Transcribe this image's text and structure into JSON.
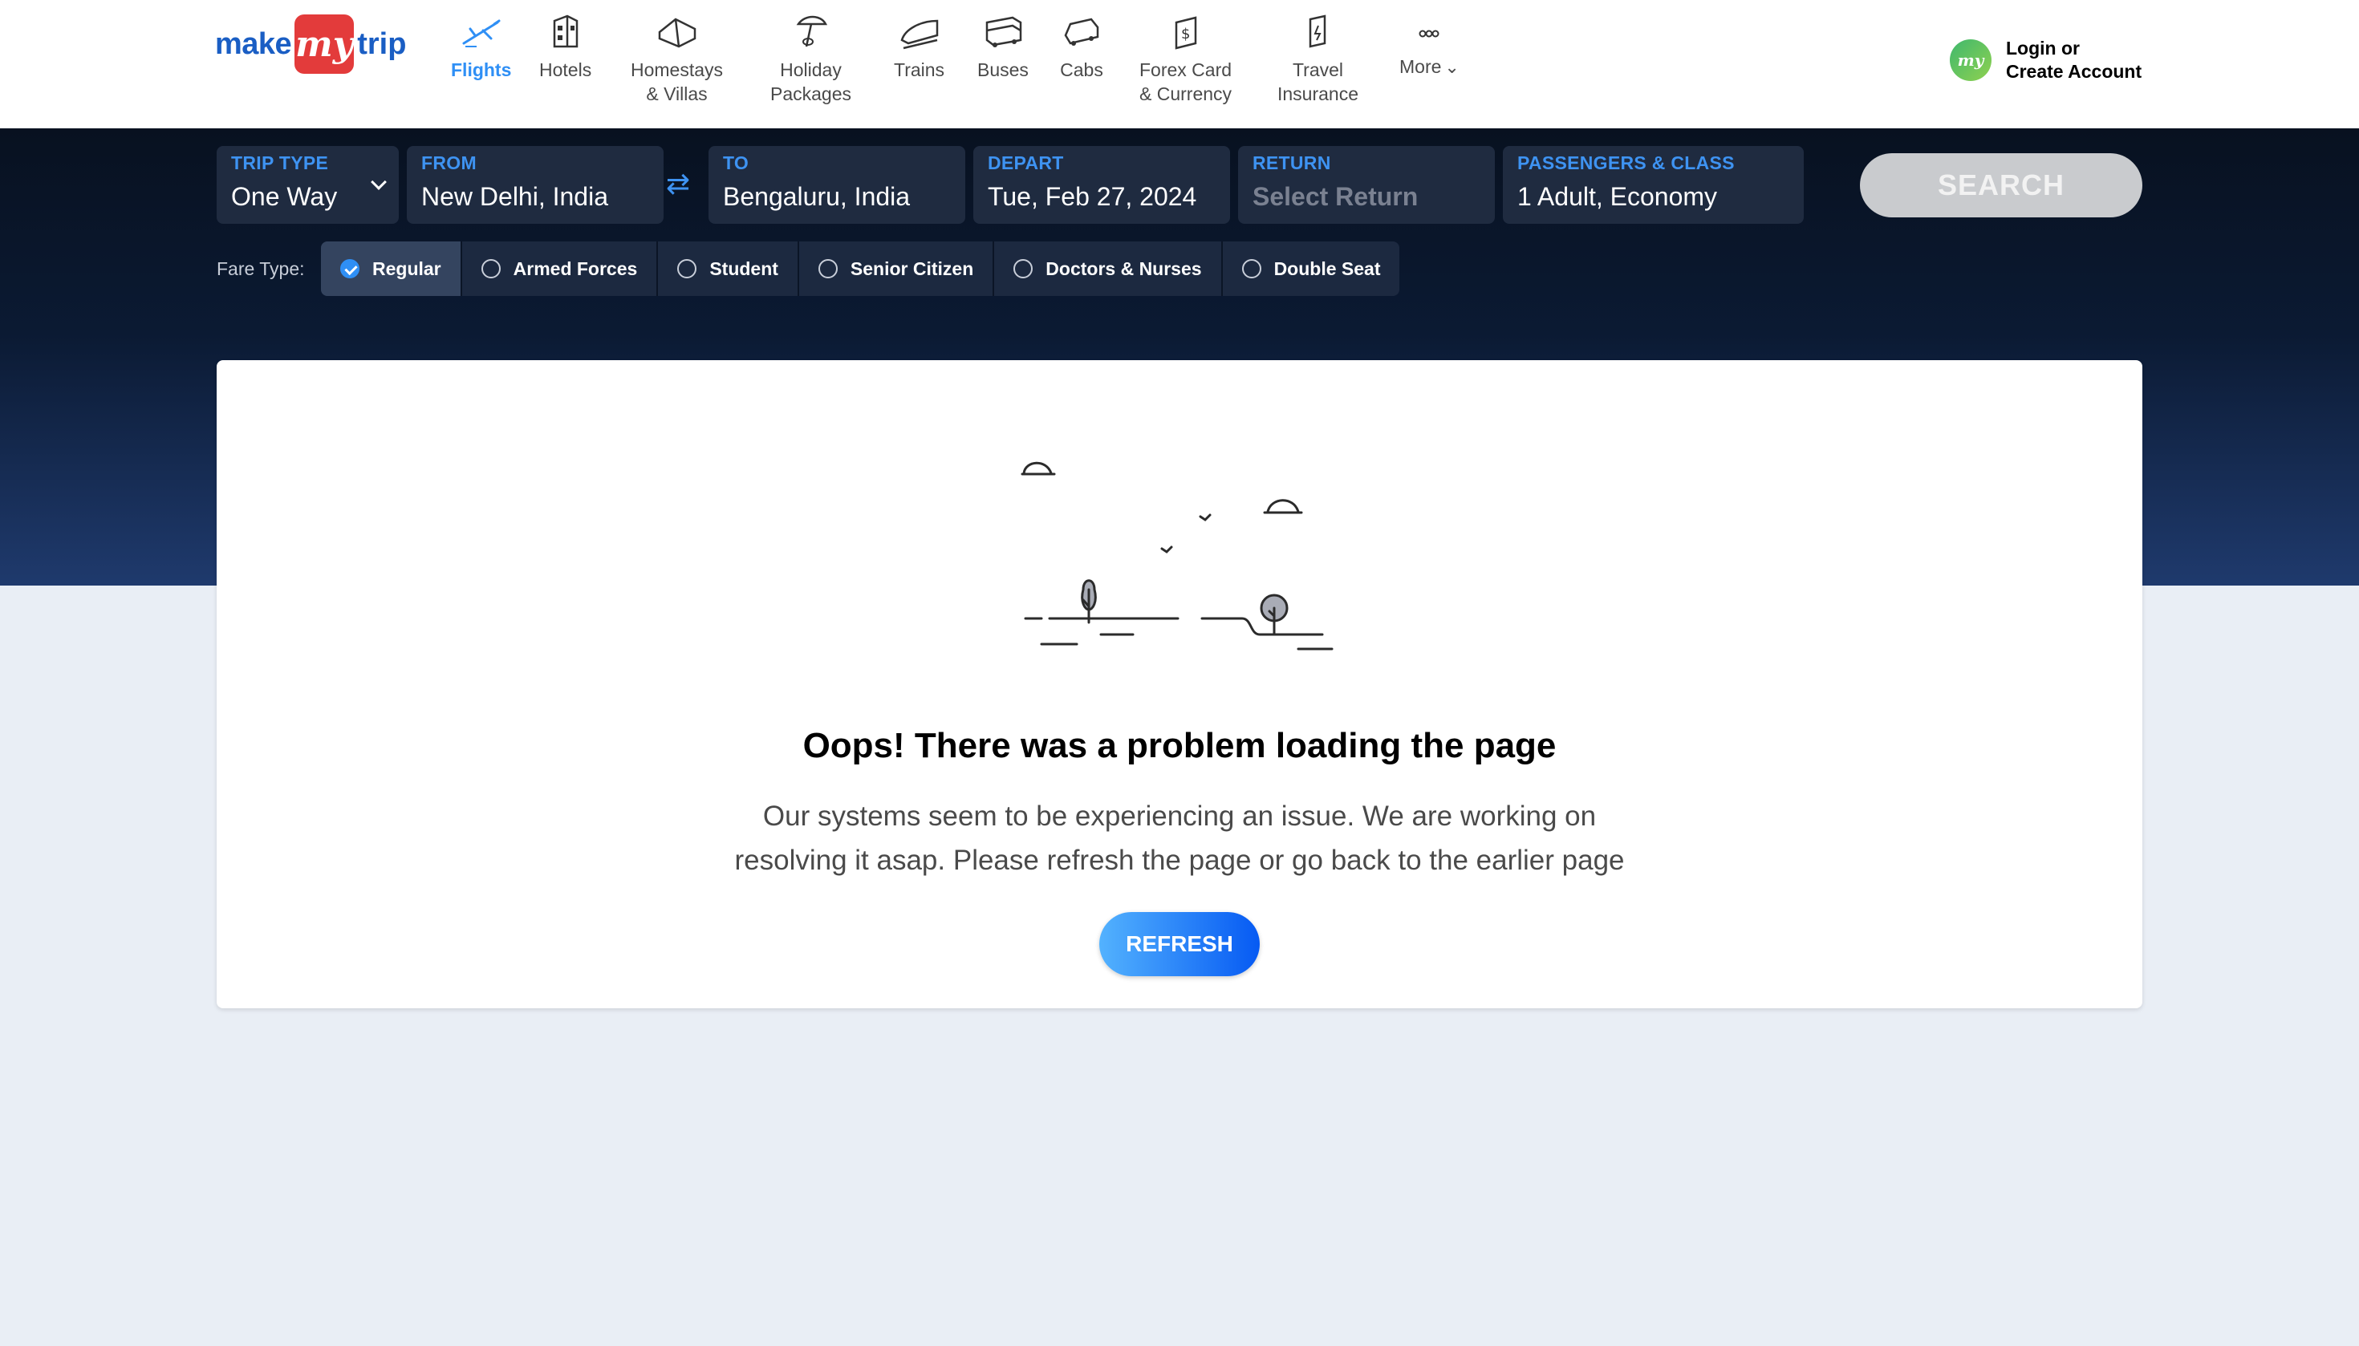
{
  "brand": {
    "part1": "make",
    "part2": "my",
    "part3": "trip"
  },
  "nav": [
    {
      "label": "Flights",
      "icon": "plane-icon",
      "active": true
    },
    {
      "label": "Hotels",
      "icon": "hotel-icon"
    },
    {
      "label1": "Homestays",
      "label2": "& Villas",
      "icon": "homestay-icon"
    },
    {
      "label1": "Holiday",
      "label2": "Packages",
      "icon": "holiday-icon"
    },
    {
      "label": "Trains",
      "icon": "train-icon"
    },
    {
      "label": "Buses",
      "icon": "bus-icon"
    },
    {
      "label": "Cabs",
      "icon": "cab-icon"
    },
    {
      "label1": "Forex Card",
      "label2": "& Currency",
      "icon": "forex-icon"
    },
    {
      "label1": "Travel",
      "label2": "Insurance",
      "icon": "insurance-icon"
    },
    {
      "label": "More",
      "icon": "more-icon"
    }
  ],
  "login": {
    "avatar": "my",
    "line1": "Login or",
    "line2": "Create Account"
  },
  "search": {
    "trip_type": {
      "label": "TRIP TYPE",
      "value": "One Way"
    },
    "from": {
      "label": "FROM",
      "value": "New Delhi, India"
    },
    "to": {
      "label": "TO",
      "value": "Bengaluru, India"
    },
    "depart": {
      "label": "DEPART",
      "value": "Tue, Feb 27, 2024"
    },
    "return": {
      "label": "RETURN",
      "placeholder": "Select Return"
    },
    "passengers": {
      "label": "PASSENGERS & CLASS",
      "value": "1 Adult, Economy"
    },
    "button": "SEARCH"
  },
  "fare": {
    "label": "Fare Type:",
    "options": [
      "Regular",
      "Armed Forces",
      "Student",
      "Senior Citizen",
      "Doctors & Nurses",
      "Double Seat"
    ],
    "selected": "Regular"
  },
  "error": {
    "title": "Oops! There was a problem loading the page",
    "line1": "Our systems seem to be experiencing an issue. We are working on",
    "line2": "resolving it asap. Please refresh the page or go back to the earlier page",
    "button": "REFRESH"
  },
  "colors": {
    "accent": "#2f8ff5",
    "brand_red": "#e33b3b",
    "brand_blue": "#1a5ec4"
  }
}
